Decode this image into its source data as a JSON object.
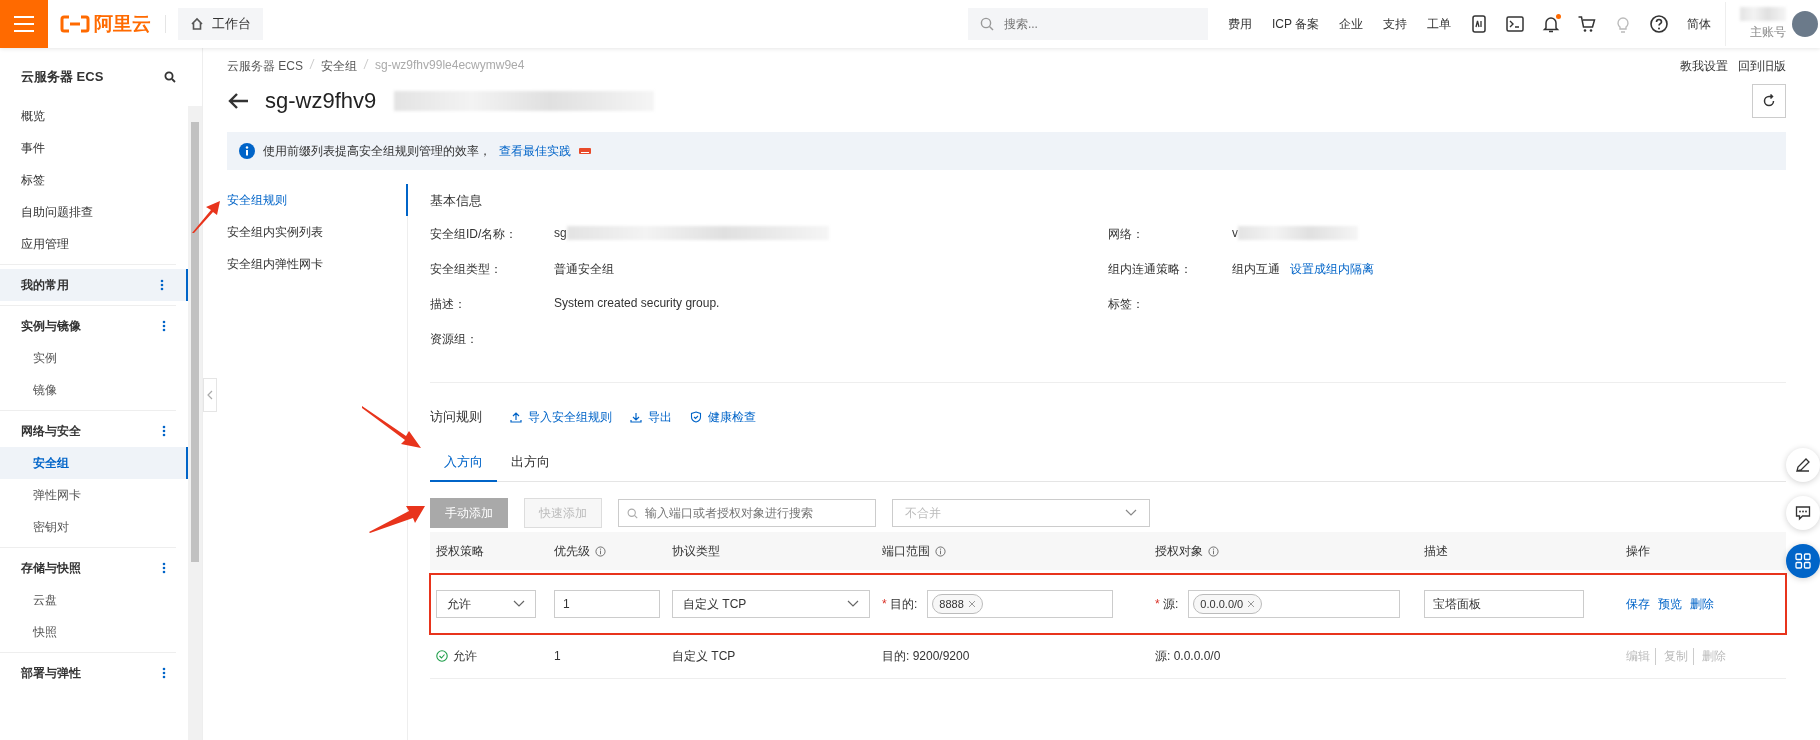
{
  "topbar": {
    "logo": "阿里云",
    "workbench": "工作台",
    "search": {
      "placeholder": "搜索..."
    },
    "links": [
      "费用",
      "ICP 备案",
      "企业",
      "支持",
      "工单"
    ],
    "notification_unread": true,
    "language": "简体",
    "account": "主账号"
  },
  "sidebar": {
    "title": "云服务器 ECS",
    "items": [
      {
        "label": "概览",
        "selected": false
      },
      {
        "label": "事件",
        "selected": false
      },
      {
        "label": "标签",
        "selected": false
      },
      {
        "label": "自助问题排查",
        "selected": false
      },
      {
        "label": "应用管理",
        "selected": false
      }
    ],
    "groups": [
      {
        "label": "我的常用",
        "selected": true
      },
      {
        "label": "实例与镜像",
        "selected": false,
        "children": [
          {
            "label": "实例",
            "selected": false
          },
          {
            "label": "镜像",
            "selected": false
          }
        ]
      },
      {
        "label": "网络与安全",
        "selected": false,
        "children": [
          {
            "label": "安全组",
            "selected": true
          },
          {
            "label": "弹性网卡",
            "selected": false
          },
          {
            "label": "密钥对",
            "selected": false
          }
        ]
      },
      {
        "label": "存储与快照",
        "selected": false,
        "children": [
          {
            "label": "云盘",
            "selected": false
          },
          {
            "label": "快照",
            "selected": false
          }
        ]
      },
      {
        "label": "部署与弹性",
        "selected": false
      }
    ]
  },
  "breadcrumb": [
    "云服务器 ECS",
    "安全组",
    "sg-wz9fhv99le4ecwymw9e4"
  ],
  "page_title": "sg-wz9fhv9",
  "header_links": [
    "教我设置",
    "回到旧版"
  ],
  "notice": {
    "text": "使用前缀列表提高安全组规则管理的效率，",
    "link": "查看最佳实践"
  },
  "subnav": [
    {
      "label": "安全组规则",
      "selected": true,
      "marked": true
    },
    {
      "label": "安全组内实例列表",
      "selected": false,
      "marked": false
    },
    {
      "label": "安全组内弹性网卡",
      "selected": false,
      "marked": false
    }
  ],
  "basic_info": {
    "title": "基本信息",
    "left_fields": [
      {
        "label": "安全组ID/名称：",
        "value": "sg",
        "redacted": true
      },
      {
        "label": "安全组类型：",
        "value": "普通安全组",
        "redacted": false
      },
      {
        "label": "描述：",
        "value": "System created security group.",
        "redacted": false
      },
      {
        "label": "资源组：",
        "redacted": false
      }
    ],
    "right_fields": [
      {
        "label": "网络：",
        "value": "v",
        "redacted": true
      },
      {
        "label": "组内连通策略：",
        "value": "组内互通",
        "link": "设置成组内隔离",
        "redacted": false
      },
      {
        "label": "标签：",
        "redacted": false
      }
    ]
  },
  "rules": {
    "title": "访问规则",
    "actions": [
      {
        "label": "导入安全组规则",
        "kind": "upload"
      },
      {
        "label": "导出",
        "kind": "download"
      },
      {
        "label": "健康检查",
        "kind": "shield"
      }
    ],
    "tabs": [
      {
        "label": "入方向",
        "selected": true,
        "marked": true
      },
      {
        "label": "出方向",
        "selected": false,
        "marked": false
      }
    ],
    "buttons": [
      {
        "label": "手动添加",
        "kind": "primary",
        "disabled": true,
        "marked": true
      },
      {
        "label": "快速添加",
        "kind": "normal",
        "disabled": true,
        "marked": false
      }
    ],
    "search": {
      "placeholder": "输入端口或者授权对象进行搜索"
    },
    "merge_select": {
      "placeholder": "不合并"
    },
    "table": {
      "columns": [
        {
          "label": "授权策略",
          "info": false
        },
        {
          "label": "优先级",
          "info": true
        },
        {
          "label": "协议类型",
          "info": false
        },
        {
          "label": "端口范围",
          "info": true
        },
        {
          "label": "授权对象",
          "info": true
        },
        {
          "label": "描述",
          "info": false
        },
        {
          "label": "操作",
          "info": false
        }
      ],
      "edit_row": {
        "highlighted": true,
        "policy": "允许",
        "priority": "1",
        "protocol": "自定义 TCP",
        "port_mark": "*",
        "port_label": "目的:",
        "source_mark": "*",
        "port_tags": [
          "8888"
        ],
        "source_label": "源:",
        "source_tags": [
          "0.0.0.0/0"
        ],
        "description": "宝塔面板",
        "actions": [
          "保存",
          "预览",
          "删除"
        ]
      },
      "rows": [
        {
          "policy": "允许",
          "allowed": true,
          "priority": "1",
          "protocol": "自定义 TCP",
          "port": "目的: 9200/9200",
          "source": "源: 0.0.0.0/0",
          "actions": [
            {
              "label": "编辑",
              "disabled": true
            },
            {
              "label": "复制",
              "disabled": true
            },
            {
              "label": "删除",
              "disabled": true
            }
          ]
        }
      ]
    }
  }
}
